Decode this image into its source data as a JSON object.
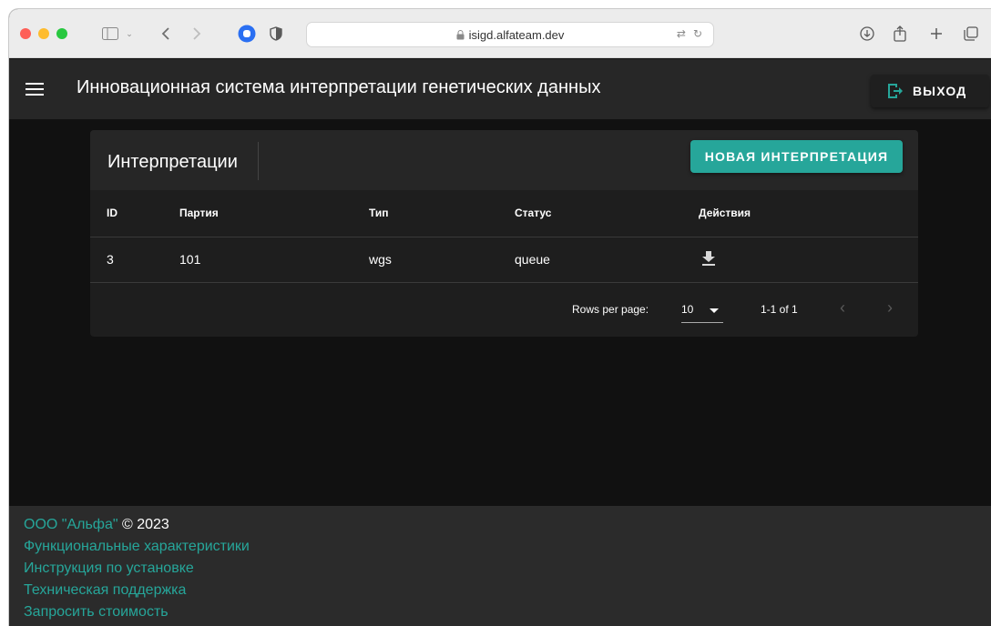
{
  "browser": {
    "url": "isigd.alfateam.dev"
  },
  "appbar": {
    "title": "Инновационная система интерпретации генетических данных",
    "logout_label": "ВЫХОД"
  },
  "card": {
    "title": "Интерпретации",
    "new_button_label": "НОВАЯ ИНТЕРПРЕТАЦИЯ",
    "columns": [
      "ID",
      "Партия",
      "Тип",
      "Статус",
      "Действия"
    ],
    "rows": [
      {
        "id": "3",
        "batch": "101",
        "type": "wgs",
        "status": "queue"
      }
    ],
    "pagination": {
      "rows_per_page_label": "Rows per page:",
      "rows_per_page_value": "10",
      "range": "1-1 of 1"
    }
  },
  "footer": {
    "company": "ООО \"Альфа\"",
    "copyright": "© 2023",
    "links": [
      "Функциональные характеристики",
      "Инструкция по установке",
      "Техническая поддержка",
      "Запросить стоимость"
    ]
  },
  "colors": {
    "accent": "#26a69a",
    "appbar_bg": "#272727",
    "page_bg": "#111111"
  }
}
